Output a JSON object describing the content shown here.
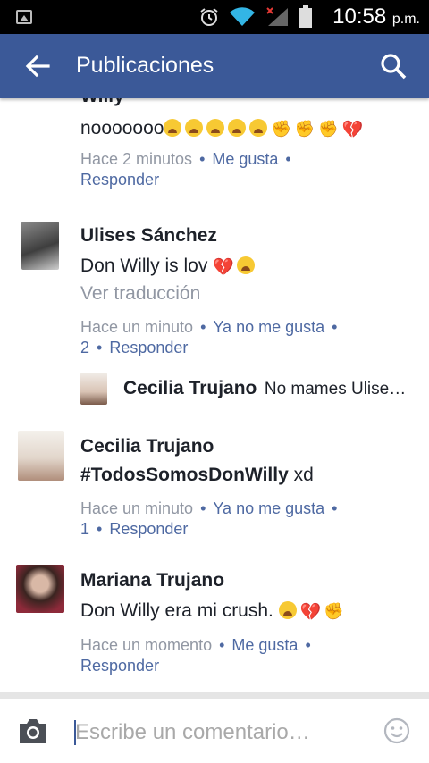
{
  "status_bar": {
    "time": "10:58",
    "ampm": "p.m."
  },
  "app_bar": {
    "title": "Publicaciones"
  },
  "comments": [
    {
      "name_partial": "Willy",
      "text": "nooooooo",
      "meta": {
        "time": "Hace 2 minutos",
        "like": "Me gusta",
        "reply": "Responder"
      }
    },
    {
      "name": "Ulises Sánchez",
      "text": "Don Willy is lov",
      "translate": "Ver traducción",
      "meta": {
        "time": "Hace un minuto",
        "like": "Ya no me gusta",
        "count": "2",
        "reply": "Responder"
      },
      "reply_preview": {
        "name": "Cecilia Trujano",
        "text": "No mames Ulise…"
      }
    },
    {
      "name": "Cecilia Trujano",
      "hashtag": "#TodosSomosDonWilly",
      "text_after": " xd",
      "meta": {
        "time": "Hace un minuto",
        "like": "Ya no me gusta",
        "count": "1",
        "reply": "Responder"
      }
    },
    {
      "name": "Mariana Trujano",
      "text": "Don Willy era mi crush.",
      "meta": {
        "time": "Hace un momento",
        "like": "Me gusta",
        "reply": "Responder"
      }
    }
  ],
  "composer": {
    "placeholder": "Escribe un comentario…"
  },
  "colors": {
    "brand": "#3b5998",
    "link": "#4e69a2",
    "meta": "#9197a3"
  },
  "icons": [
    "back-arrow-icon",
    "search-icon",
    "camera-icon",
    "smiley-icon",
    "alarm-icon",
    "wifi-icon",
    "signal-icon",
    "battery-icon"
  ]
}
